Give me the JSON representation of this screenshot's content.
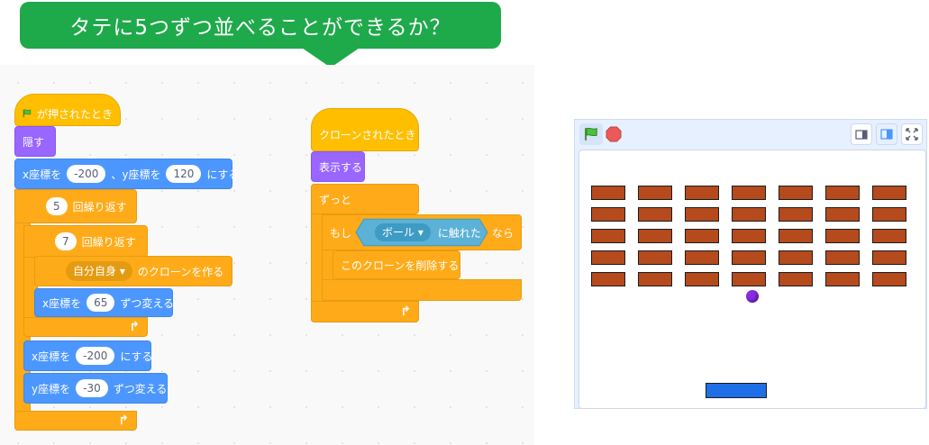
{
  "banner": {
    "text": "タテに5つずつ並べることができるか？"
  },
  "script1": {
    "hat_label": "が押されたとき",
    "hide_label": "隠す",
    "goto": {
      "x_prefix": "x座標を",
      "x_value": "-200",
      "y_prefix": "、y座標を",
      "y_value": "120",
      "suffix": "にする"
    },
    "repeat_outer": {
      "count": "5",
      "label": "回繰り返す"
    },
    "repeat_inner": {
      "count": "7",
      "label": "回繰り返す"
    },
    "create_clone": {
      "target": "自分自身",
      "label": "のクローンを作る"
    },
    "change_x": {
      "prefix": "x座標を",
      "value": "65",
      "suffix": "ずつ変える"
    },
    "set_x": {
      "prefix": "x座標を",
      "value": "-200",
      "suffix": "にする"
    },
    "change_y": {
      "prefix": "y座標を",
      "value": "-30",
      "suffix": "ずつ変える"
    }
  },
  "script2": {
    "hat_label": "クローンされたとき",
    "show_label": "表示する",
    "forever_label": "ずっと",
    "if_label": "もし",
    "touching": {
      "target": "ボール",
      "label": "に触れた"
    },
    "then_label": "なら",
    "delete_label": "このクローンを削除する"
  },
  "stage": {
    "brick_color": "#b54a1d",
    "ball_color": "#8a2be2",
    "paddle_color": "#1e6fe6"
  },
  "icons": {
    "flag": "green-flag-icon",
    "stop": "stop-icon",
    "loop": "loop-arrow-icon"
  }
}
